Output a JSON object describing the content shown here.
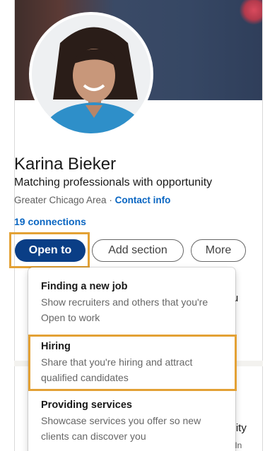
{
  "profile": {
    "name": "Karina Bieker",
    "headline": "Matching professionals with opportunity",
    "location": "Greater Chicago Area",
    "separator": "·",
    "contact_info": "Contact info",
    "connections": "19 connections"
  },
  "actions": {
    "open_to": "Open to",
    "add_section": "Add section",
    "more": "More"
  },
  "open_to_menu": {
    "items": [
      {
        "title": "Finding a new job",
        "description": "Show recruiters and others that you're Open to work"
      },
      {
        "title": "Hiring",
        "description": "Share that you're hiring and attract qualified candidates"
      },
      {
        "title": "Providing services",
        "description": "Showcase services you offer so new clients can discover you"
      }
    ]
  },
  "background": {
    "text_1": "you",
    "text_2": "tunity",
    "text_3": "kedIn"
  },
  "colors": {
    "primary_button": "#0a3e86",
    "link": "#0a66c2",
    "highlight": "#e3a135"
  }
}
